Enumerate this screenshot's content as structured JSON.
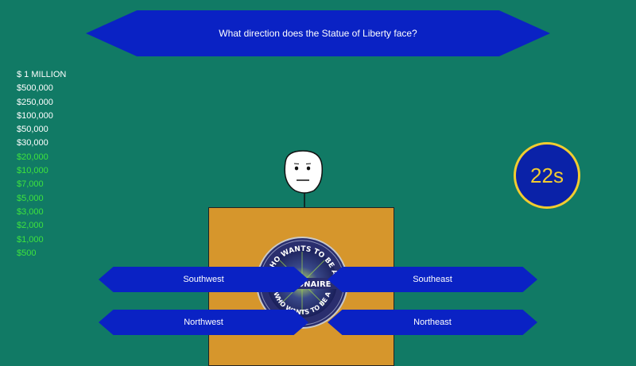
{
  "question": {
    "text": "What direction does the Statue of Liberty face?"
  },
  "ladder": [
    {
      "amount": "$ 1 MILLION",
      "status": "pending"
    },
    {
      "amount": "$500,000",
      "status": "pending"
    },
    {
      "amount": "$250,000",
      "status": "pending"
    },
    {
      "amount": "$100,000",
      "status": "pending"
    },
    {
      "amount": "$50,000",
      "status": "pending"
    },
    {
      "amount": "$30,000",
      "status": "pending"
    },
    {
      "amount": "$20,000",
      "status": "won"
    },
    {
      "amount": "$10,000",
      "status": "won"
    },
    {
      "amount": "$7,000",
      "status": "won"
    },
    {
      "amount": "$5,000",
      "status": "won"
    },
    {
      "amount": "$3,000",
      "status": "won"
    },
    {
      "amount": "$2,000",
      "status": "won"
    },
    {
      "amount": "$1,000",
      "status": "won"
    },
    {
      "amount": "$500",
      "status": "won"
    }
  ],
  "timer": {
    "label": "22s"
  },
  "answers": [
    {
      "label": "Southwest"
    },
    {
      "label": "Southeast"
    },
    {
      "label": "Northwest"
    },
    {
      "label": "Northeast"
    }
  ],
  "logo": {
    "text_top": "WHO WANTS TO BE A",
    "text_mid": "MILLIONAIRE",
    "text_bottom": "WHO WANTS TO BE A"
  },
  "colors": {
    "background": "#117a65",
    "panel_blue": "#0a22c4",
    "timer_ring": "#f2cc2f",
    "ladder_won": "#3ee23e",
    "podium": "#d6962c"
  }
}
